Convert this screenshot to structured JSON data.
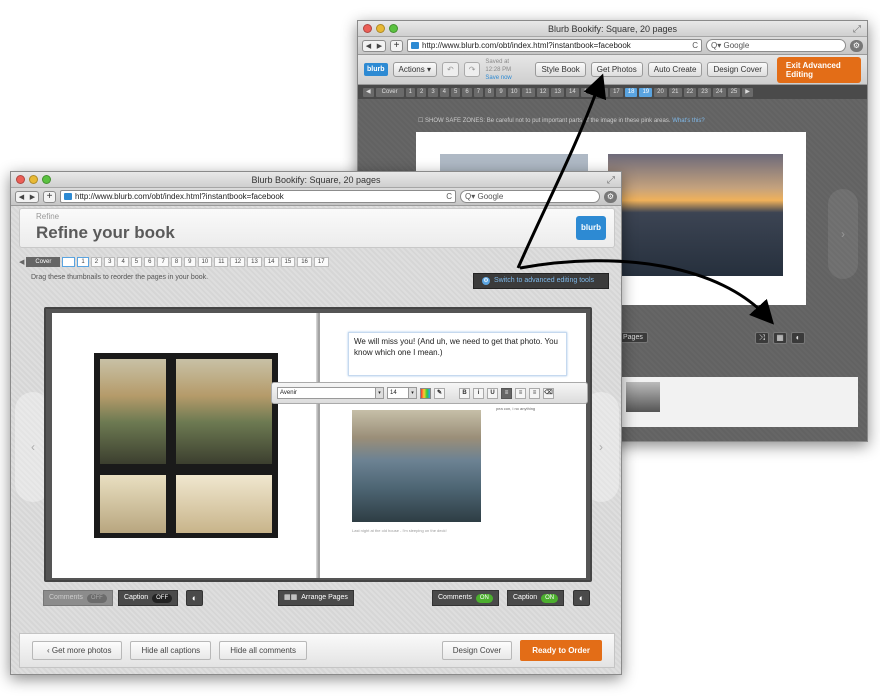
{
  "back_window": {
    "title": "Blurb Bookify: Square, 20 pages",
    "url": "http://www.blurb.com/obt/index.html?instantbook=facebook",
    "search_placeholder": "Google",
    "logo": "blurb",
    "actions_label": "Actions",
    "saved_text": "Saved at 12:28 PM",
    "save_now": "Save now",
    "tool_buttons": [
      "Style Book",
      "Get Photos",
      "Auto Create",
      "Design Cover"
    ],
    "exit_label": "Exit Advanced Editing",
    "pages": [
      "Cover",
      "1",
      "2",
      "3",
      "4",
      "5",
      "6",
      "7",
      "8",
      "9",
      "10",
      "11",
      "12",
      "13",
      "14",
      "15",
      "16",
      "17",
      "18",
      "19",
      "20",
      "21",
      "22",
      "23",
      "24",
      "25"
    ],
    "selected_pages": [
      "18",
      "19"
    ],
    "safe_zones": "SHOW SAFE ZONES:",
    "safe_zones_desc": "Be careful not to put important parts of the image in these pink areas.",
    "whats_this": "What's this?",
    "pages_label": "Pages"
  },
  "front_window": {
    "title": "Blurb Bookify: Square, 20 pages",
    "url": "http://www.blurb.com/obt/index.html?instantbook=facebook",
    "search_placeholder": "Google",
    "refine_small": "Refine",
    "refine_title": "Refine your book",
    "logo": "blurb",
    "pages": [
      "Cover",
      "",
      "1",
      "2",
      "3",
      "4",
      "5",
      "6",
      "7",
      "8",
      "9",
      "10",
      "11",
      "12",
      "13",
      "14",
      "15",
      "16",
      "17"
    ],
    "drag_hint": "Drag these thumbnails to reorder the pages in your book.",
    "switch_label": "Switch to advanced editing tools",
    "comment_text": "We will miss you! (And uh, we need to get that photo. You know which one I mean.)",
    "font_value": "Avenir",
    "size_value": "14",
    "format_buttons": [
      "B",
      "i",
      "U"
    ],
    "right_text_tail": "pea con, i no anything",
    "city_caption": "Last night at the old house - I'm sleeping on the deck!",
    "left_controls": {
      "comments": "Comments",
      "comments_state": "OFF",
      "caption": "Caption",
      "caption_state": "OFF"
    },
    "arrange_label": "Arrange Pages",
    "right_controls": {
      "comments": "Comments",
      "comments_state": "ON",
      "caption": "Caption",
      "caption_state": "ON"
    },
    "bottom": {
      "get_more": "Get more photos",
      "hide_captions": "Hide all captions",
      "hide_comments": "Hide all comments",
      "design_cover": "Design Cover",
      "ready": "Ready to Order"
    }
  },
  "colors": {
    "accent_orange": "#e36d17",
    "brand_blue": "#2d8ad3",
    "toggle_green": "#4caf2e"
  },
  "icons": [
    "close-light",
    "minimize-light",
    "zoom-light",
    "back-forward",
    "plus",
    "reload",
    "search",
    "gear",
    "shuffle",
    "grid",
    "palette",
    "undo",
    "redo"
  ]
}
